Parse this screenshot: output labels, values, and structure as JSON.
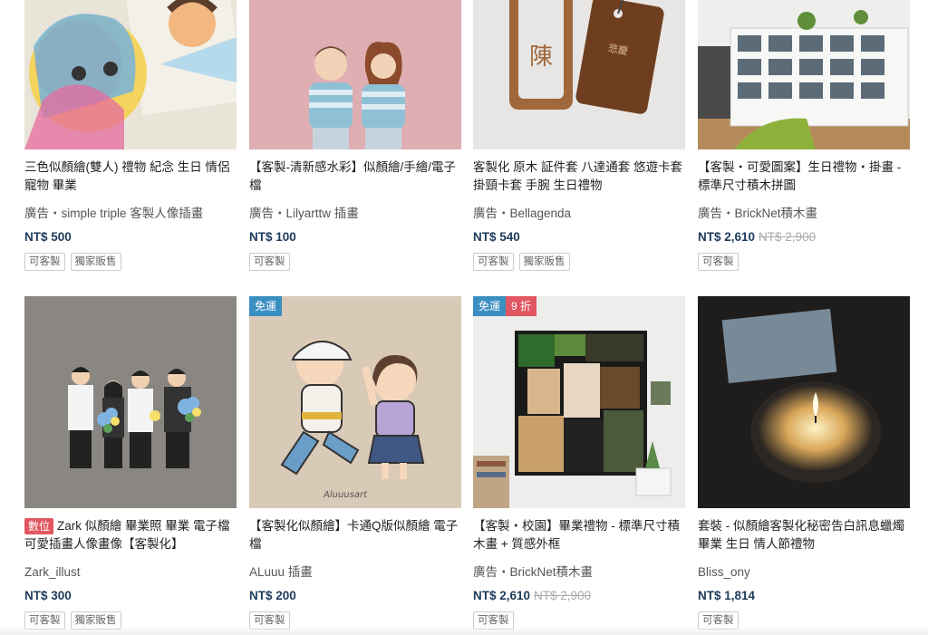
{
  "products": [
    {
      "id": "p1",
      "title": "三色似顏繪(雙人) 禮物 紀念 生日 情侶 寵物 畢業",
      "shop": "廣告・simple triple 客製人像插畫",
      "price": "NT$ 500",
      "old_price": "",
      "tags": [
        "可客製",
        "獨家販售"
      ],
      "flags": [],
      "digital_badge": "",
      "image": "colorful-portrait-illustration"
    },
    {
      "id": "p2",
      "title": "【客製-清新感水彩】似顏繪/手繪/電子檔",
      "shop": "廣告・Lilyarttw 插畫",
      "price": "NT$ 100",
      "old_price": "",
      "tags": [
        "可客製"
      ],
      "flags": [],
      "digital_badge": "",
      "image": "couple-watercolor-portrait"
    },
    {
      "id": "p3",
      "title": "客製化 原木 証件套 八達通套 悠遊卡套 掛頸卡套 手腕 生日禮物",
      "shop": "廣告・Bellagenda",
      "price": "NT$ 540",
      "old_price": "",
      "tags": [
        "可客製",
        "獨家販售"
      ],
      "flags": [],
      "digital_badge": "",
      "image": "wooden-card-holders"
    },
    {
      "id": "p4",
      "title": "【客製・可愛圖案】生日禮物・掛畫 - 標準尺寸積木拼圖",
      "shop": "廣告・BrickNet積木畫",
      "price": "NT$ 2,610",
      "old_price": "NT$ 2,900",
      "tags": [
        "可客製"
      ],
      "flags": [],
      "digital_badge": "",
      "image": "room-with-shelves"
    },
    {
      "id": "p5",
      "title": "Zark 似顏繪 畢業照 畢業 電子檔可愛插畫人像畫像【客製化】",
      "shop": "Zark_illust",
      "price": "NT$ 300",
      "old_price": "",
      "tags": [
        "可客製",
        "獨家販售"
      ],
      "flags": [],
      "digital_badge": "數位",
      "image": "graduation-group-illustration"
    },
    {
      "id": "p6",
      "title": "【客製化似顏繪】卡通Q版似顏繪 電子檔",
      "shop": "ALuuu 插畫",
      "price": "NT$ 200",
      "old_price": "",
      "tags": [
        "可客製"
      ],
      "flags": [
        "免運"
      ],
      "digital_badge": "",
      "image": "cartoon-kids-illustration",
      "image_signature": "Aluuusart"
    },
    {
      "id": "p7",
      "title": "【客製・校園】畢業禮物 - 標準尺寸積木畫 + 質感外框",
      "shop": "廣告・BrickNet積木畫",
      "price": "NT$ 2,610",
      "old_price": "NT$ 2,900",
      "tags": [
        "可客製"
      ],
      "flags": [
        "免運",
        "9 折"
      ],
      "digital_badge": "",
      "image": "pixel-brick-art-frame"
    },
    {
      "id": "p8",
      "title": "套裝 - 似顏繪客製化秘密告白訊息蠟燭 畢業 生日 情人節禮物",
      "shop": "Bliss_ony",
      "price": "NT$ 1,814",
      "old_price": "",
      "tags": [
        "可客製"
      ],
      "flags": [],
      "digital_badge": "",
      "image": "candle-jar-dark"
    }
  ],
  "colors": {
    "price": "#1e3a5a",
    "free_shipping_flag": "#3a8fc1",
    "discount_flag": "#e05661",
    "digital_badge": "#e05661"
  }
}
